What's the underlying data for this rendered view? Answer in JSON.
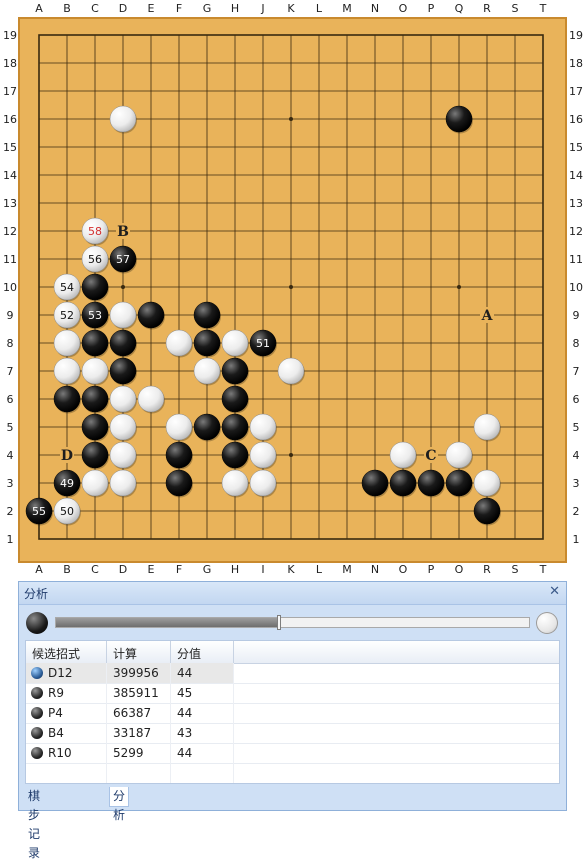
{
  "board": {
    "size": 19,
    "col_labels": [
      "A",
      "B",
      "C",
      "D",
      "E",
      "F",
      "G",
      "H",
      "J",
      "K",
      "L",
      "M",
      "N",
      "O",
      "P",
      "Q",
      "R",
      "S",
      "T"
    ],
    "row_labels": [
      "19",
      "18",
      "17",
      "16",
      "15",
      "14",
      "13",
      "12",
      "11",
      "10",
      "9",
      "8",
      "7",
      "6",
      "5",
      "4",
      "3",
      "2",
      "1"
    ],
    "colors": {
      "wood": "#e9b35a",
      "border": "#c98a2e",
      "line": "#3a2a10",
      "mark_letter": "#1e1e1e",
      "last_move_number": "#d32f2f"
    },
    "stones": [
      {
        "pt": "D16",
        "c": "w"
      },
      {
        "pt": "Q16",
        "c": "b"
      },
      {
        "pt": "C12",
        "c": "w",
        "n": "58",
        "last": true
      },
      {
        "pt": "C11",
        "c": "w",
        "n": "56"
      },
      {
        "pt": "D11",
        "c": "b",
        "n": "57"
      },
      {
        "pt": "B10",
        "c": "w",
        "n": "54"
      },
      {
        "pt": "C10",
        "c": "b"
      },
      {
        "pt": "B9",
        "c": "w",
        "n": "52"
      },
      {
        "pt": "C9",
        "c": "b",
        "n": "53"
      },
      {
        "pt": "D9",
        "c": "w"
      },
      {
        "pt": "E9",
        "c": "b"
      },
      {
        "pt": "G9",
        "c": "b"
      },
      {
        "pt": "B8",
        "c": "w"
      },
      {
        "pt": "C8",
        "c": "b"
      },
      {
        "pt": "D8",
        "c": "b"
      },
      {
        "pt": "F8",
        "c": "w"
      },
      {
        "pt": "G8",
        "c": "b"
      },
      {
        "pt": "H8",
        "c": "w"
      },
      {
        "pt": "J8",
        "c": "b",
        "n": "51"
      },
      {
        "pt": "B7",
        "c": "w"
      },
      {
        "pt": "C7",
        "c": "w"
      },
      {
        "pt": "D7",
        "c": "b"
      },
      {
        "pt": "G7",
        "c": "w"
      },
      {
        "pt": "H7",
        "c": "b"
      },
      {
        "pt": "K7",
        "c": "w"
      },
      {
        "pt": "B6",
        "c": "b"
      },
      {
        "pt": "C6",
        "c": "b"
      },
      {
        "pt": "D6",
        "c": "w"
      },
      {
        "pt": "E6",
        "c": "w"
      },
      {
        "pt": "H6",
        "c": "b"
      },
      {
        "pt": "C5",
        "c": "b"
      },
      {
        "pt": "D5",
        "c": "w"
      },
      {
        "pt": "F5",
        "c": "w"
      },
      {
        "pt": "G5",
        "c": "b"
      },
      {
        "pt": "H5",
        "c": "b"
      },
      {
        "pt": "J5",
        "c": "w"
      },
      {
        "pt": "R5",
        "c": "w"
      },
      {
        "pt": "C4",
        "c": "b"
      },
      {
        "pt": "D4",
        "c": "w"
      },
      {
        "pt": "F4",
        "c": "b"
      },
      {
        "pt": "H4",
        "c": "b"
      },
      {
        "pt": "J4",
        "c": "w"
      },
      {
        "pt": "O4",
        "c": "w"
      },
      {
        "pt": "Q4",
        "c": "w"
      },
      {
        "pt": "B3",
        "c": "b",
        "n": "49"
      },
      {
        "pt": "C3",
        "c": "w"
      },
      {
        "pt": "D3",
        "c": "w"
      },
      {
        "pt": "F3",
        "c": "b"
      },
      {
        "pt": "H3",
        "c": "w"
      },
      {
        "pt": "J3",
        "c": "w"
      },
      {
        "pt": "N3",
        "c": "b"
      },
      {
        "pt": "O3",
        "c": "b"
      },
      {
        "pt": "P3",
        "c": "b"
      },
      {
        "pt": "Q3",
        "c": "b"
      },
      {
        "pt": "R3",
        "c": "w"
      },
      {
        "pt": "A2",
        "c": "b",
        "n": "55"
      },
      {
        "pt": "B2",
        "c": "w",
        "n": "50"
      },
      {
        "pt": "R2",
        "c": "b"
      }
    ],
    "marks": [
      {
        "pt": "R9",
        "label": "A"
      },
      {
        "pt": "D12",
        "label": "B"
      },
      {
        "pt": "P4",
        "label": "C"
      },
      {
        "pt": "B4",
        "label": "D"
      }
    ],
    "hoshi": [
      "D16",
      "K16",
      "Q16",
      "D10",
      "K10",
      "Q10",
      "D4",
      "K4",
      "Q4"
    ]
  },
  "panel": {
    "title": "分析",
    "close_icon": "✕",
    "progress": 0.47,
    "table": {
      "headers": [
        "候选招式",
        "计算",
        "分值"
      ],
      "rows": [
        {
          "move": "D12",
          "calc": "399956",
          "score": "44",
          "selected": true,
          "icon": "blue"
        },
        {
          "move": "R9",
          "calc": "385911",
          "score": "45",
          "selected": false,
          "icon": "black"
        },
        {
          "move": "P4",
          "calc": "66387",
          "score": "44",
          "selected": false,
          "icon": "black"
        },
        {
          "move": "B4",
          "calc": "33187",
          "score": "43",
          "selected": false,
          "icon": "black"
        },
        {
          "move": "R10",
          "calc": "5299",
          "score": "44",
          "selected": false,
          "icon": "black"
        }
      ]
    },
    "tabs": [
      "棋步记录",
      "分析"
    ],
    "active_tab": "分析"
  }
}
